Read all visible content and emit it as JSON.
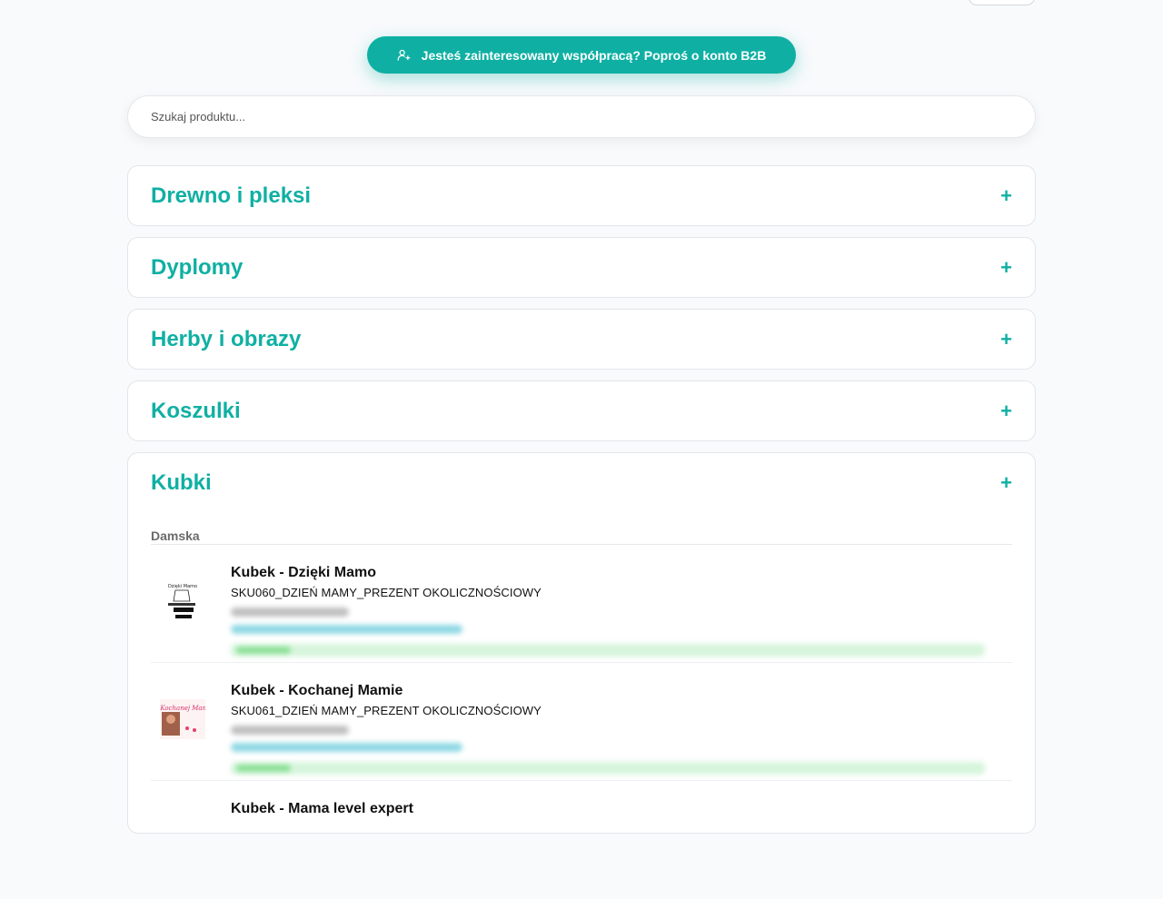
{
  "b2b_button": {
    "label": "Jesteś zainteresowany współpracą? Poproś o konto B2B",
    "icon": "user-plus-icon"
  },
  "search": {
    "placeholder": "Szukaj produktu..."
  },
  "categories": [
    {
      "title": "Drewno i pleksi",
      "toggle": "+"
    },
    {
      "title": "Dyplomy",
      "toggle": "+"
    },
    {
      "title": "Herby i obrazy",
      "toggle": "+"
    },
    {
      "title": "Koszulki",
      "toggle": "+"
    },
    {
      "title": "Kubki",
      "toggle": "+"
    }
  ],
  "kubki": {
    "subcategory": "Damska",
    "products": [
      {
        "name": "Kubek - Dzięki Mamo",
        "sku": "SKU060_DZIEŃ MAMY_PREZENT OKOLICZNOŚCIOWY",
        "thumb_text": "Dzięki Mamo"
      },
      {
        "name": "Kubek - Kochanej Mamie",
        "sku": "SKU061_DZIEŃ MAMY_PREZENT OKOLICZNOŚCIOWY",
        "thumb_text": "Kochanej Mamie"
      },
      {
        "name": "Kubek - Mama level expert",
        "sku": ""
      }
    ]
  },
  "colors": {
    "accent": "#0fb0a3"
  }
}
